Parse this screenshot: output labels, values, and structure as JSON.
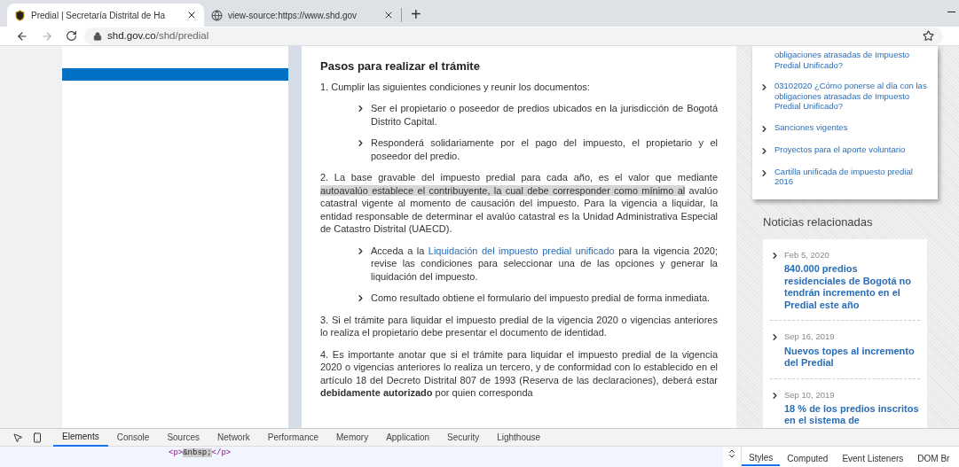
{
  "browser": {
    "tabs": [
      {
        "title": "Predial | Secretaría Distrital de Ha",
        "selected": true,
        "kind": "shield"
      },
      {
        "title": "view-source:https://www.shd.gov",
        "selected": false,
        "kind": "globe"
      }
    ],
    "new_tab": "+",
    "url_host": "shd.gov.co",
    "url_path": "/shd/predial"
  },
  "article": {
    "heading": "Pasos para realizar el trámite",
    "blocks": [
      {
        "kind": "para",
        "segments": [
          {
            "text": "1. Cumplir las siguientes condiciones y reunir los documentos:",
            "highlighted": false
          }
        ]
      },
      {
        "kind": "bullet",
        "text": "Ser el propietario o poseedor de predios ubicados en la jurisdicción de Bogotá Distrito Capital."
      },
      {
        "kind": "bullet",
        "text": "Responderá solidariamente por el pago del impuesto, el propietario y el poseedor del predio."
      },
      {
        "kind": "para",
        "segments": [
          {
            "text": "2. La base gravable del impuesto predial para cada año, es el valor que mediante ",
            "highlighted": false
          },
          {
            "text": "autoavalúo establece el contribuyente, la cual debe corresponder como mínimo al",
            "highlighted": true
          },
          {
            "text": " avalúo catastral vigente al           momento de causación del impuesto. Para la vigencia a liquidar, la entidad responsable de determinar el avalúo catastral es la Unidad Administrativa Especial de Catastro Distrital (UAECD).",
            "highlighted": false
          }
        ]
      },
      {
        "kind": "bullet",
        "before": "Acceda a la ",
        "link": "Liquidación del impuesto predial unificado",
        "text": " para la vigencia 2020; revise las condiciones para seleccionar una de las opciones y generar la liquidación del impuesto."
      },
      {
        "kind": "bullet",
        "text": "Como resultado obtiene el formulario del impuesto predial de forma inmediata."
      },
      {
        "kind": "para",
        "segments": [
          {
            "text": "3. Si el trámite para liquidar el impuesto predial de la vigencia 2020 o vigencias anteriores lo realiza el propietario debe presentar el documento de identidad.",
            "highlighted": false
          }
        ]
      },
      {
        "kind": "rich",
        "text": "4. Es importante anotar que si el trámite para liquidar el impuesto predial de la vigencia 2020 o vigencias anteriores lo realiza un tercero, y de conformidad con lo establecido en el artículo 18 del        Decreto Distrital 807 de 1993 (Reserva de las declaraciones), deberá estar **debidamente autorizado** por quien corresponda"
      }
    ]
  },
  "related_links": {
    "items": [
      "obligaciones atrasadas de Impuesto Predial Unificado?",
      "03102020 ¿Cómo ponerse al día con las obligaciones atrasadas de Impuesto Predial Unificado?",
      "Sanciones vigentes",
      "Proyectos para el aporte voluntario",
      "Cartilla unificada de impuesto predial 2016"
    ]
  },
  "news": {
    "title": "Noticias relacionadas",
    "items": [
      {
        "date": "Feb 5, 2020",
        "headline": "840.000 predios residenciales de Bogotá no tendrán incremento en el Predial este año"
      },
      {
        "date": "Sep 16, 2019",
        "headline": "Nuevos topes al incremento del Predial"
      },
      {
        "date": "Sep 10, 2019",
        "headline": "18 % de los predios inscritos en el sistema de"
      }
    ]
  },
  "devtools": {
    "tabs": [
      {
        "label": "Elements",
        "selected": true
      },
      {
        "label": "Console",
        "selected": false
      },
      {
        "label": "Sources",
        "selected": false
      },
      {
        "label": "Network",
        "selected": false
      },
      {
        "label": "Performance",
        "selected": false
      },
      {
        "label": "Memory",
        "selected": false
      },
      {
        "label": "Application",
        "selected": false
      },
      {
        "label": "Security",
        "selected": false
      },
      {
        "label": "Lighthouse",
        "selected": false
      }
    ],
    "code_open": "<p>",
    "code_entity": "&nbsp;",
    "code_close": "</p>",
    "side_tabs": [
      {
        "label": "Styles",
        "selected": true
      },
      {
        "label": "Computed",
        "selected": false
      },
      {
        "label": "Event Listeners",
        "selected": false
      },
      {
        "label": "DOM Br",
        "selected": false
      }
    ]
  }
}
